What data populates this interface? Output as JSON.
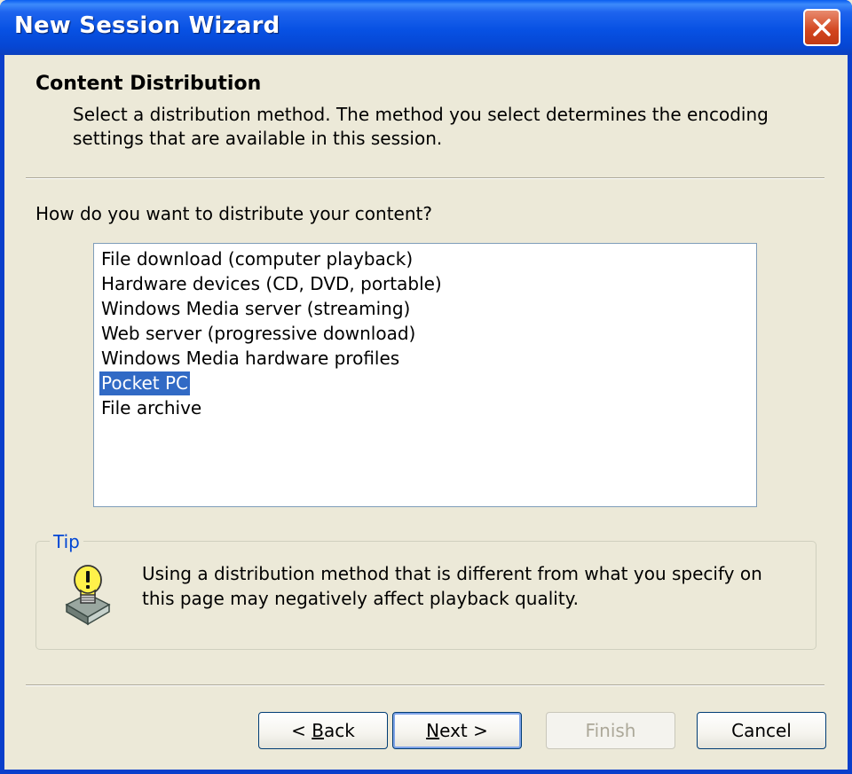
{
  "window": {
    "title": "New Session Wizard"
  },
  "header": {
    "title": "Content Distribution",
    "description": "Select a distribution method. The method you select determines the encoding settings that are available in this session."
  },
  "question": "How do you want to distribute your content?",
  "list": {
    "items": [
      "File download (computer playback)",
      "Hardware devices (CD, DVD, portable)",
      "Windows Media server (streaming)",
      "Web server (progressive download)",
      "Windows Media hardware profiles",
      "Pocket PC",
      "File archive"
    ],
    "selected_index": 5
  },
  "tip": {
    "legend": "Tip",
    "text": "Using a distribution method that is different from what you specify on this page may negatively affect playback quality.",
    "icon": "lightbulb-icon"
  },
  "buttons": {
    "back": {
      "prefix": "< ",
      "mnemonic": "B",
      "rest": "ack"
    },
    "next": {
      "mnemonic": "N",
      "rest": "ext >"
    },
    "finish": "Finish",
    "cancel": "Cancel"
  },
  "colors": {
    "selection": "#316AC5",
    "titlebar": "#0751E3",
    "dialog": "#ECE9D8",
    "close": "#D2451E"
  }
}
